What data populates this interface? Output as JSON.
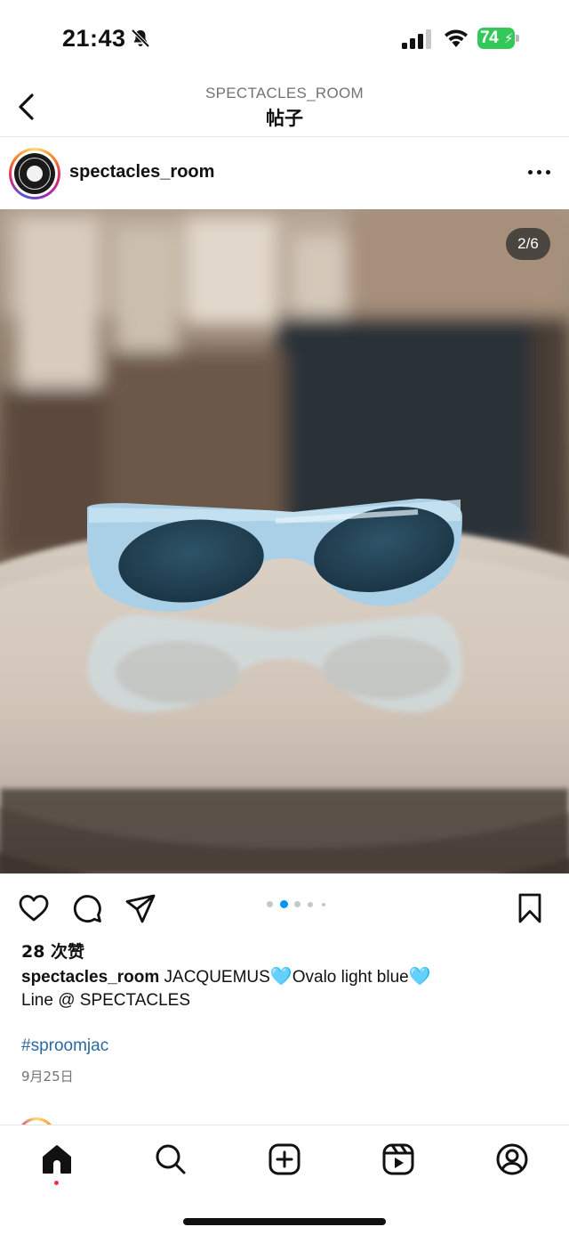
{
  "status_bar": {
    "time": "21:43",
    "battery_percent": "74",
    "icons": [
      "bell-slash-icon",
      "signal-icon",
      "wifi-icon",
      "battery-charging-icon"
    ]
  },
  "header": {
    "subtitle": "SPECTACLES_ROOM",
    "title": "帖子",
    "back_icon": "chevron-left-icon"
  },
  "post": {
    "username": "spectacles_room",
    "image_counter": "2/6",
    "carousel": {
      "current": 2,
      "total": 6
    },
    "likes": "28 次赞",
    "caption": {
      "username": "spectacles_room",
      "text_part1": " JACQUEMUS",
      "emoji1": "🩵",
      "text_part2": "Ovalo light blue",
      "emoji2": "🩵",
      "line2": "Line @ SPECTACLES"
    },
    "hashtag": "#sproomjac",
    "date": "9月25日"
  },
  "actions": {
    "icons": [
      "heart-icon",
      "comment-icon",
      "share-icon",
      "bookmark-icon"
    ]
  },
  "tab_bar": {
    "tabs": [
      "home-icon",
      "search-icon",
      "create-icon",
      "reels-icon",
      "profile-icon"
    ],
    "active": "home-icon"
  },
  "colors": {
    "link": "#2a6aa0",
    "carousel_active": "#0095f6",
    "notification_dot": "#ff3040",
    "battery": "#34c759"
  }
}
